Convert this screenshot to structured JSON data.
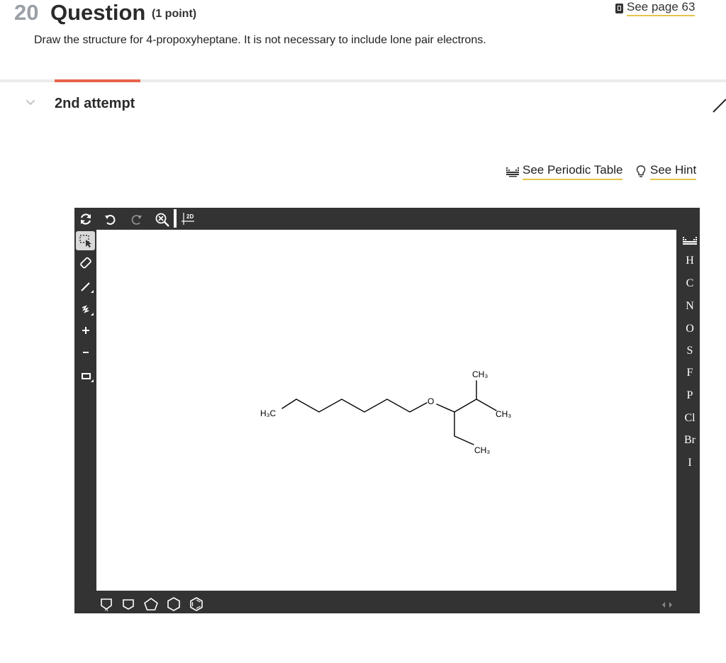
{
  "header": {
    "question_number": "20",
    "question_title": "Question",
    "points": "(1 point)",
    "see_page": "See page 63"
  },
  "prompt": "Draw the structure for 4-propoxyheptane. It is not necessary to include lone pair electrons.",
  "attempt": {
    "label": "2nd attempt"
  },
  "links": {
    "periodic_table": "See Periodic Table",
    "hint": "See Hint"
  },
  "toolbar_top": [
    "rotate-icon",
    "undo-icon",
    "redo-icon",
    "zoom-icon",
    "2d-clean-icon"
  ],
  "toolbar_top_badge": "2D",
  "toolbar_left": [
    "select-icon",
    "eraser-icon",
    "bond-icon",
    "chain-icon",
    "charge-plus-icon",
    "charge-minus-icon",
    "bracket-icon"
  ],
  "element_palette": {
    "elements": [
      "H",
      "C",
      "N",
      "O",
      "S",
      "F",
      "P",
      "Cl",
      "Br",
      "I"
    ]
  },
  "toolbar_bottom": [
    "template-icon",
    "cyclopentane-ring-icon",
    "pentagon-ring-icon",
    "hexagon-ring-icon",
    "benzene-ring-icon"
  ],
  "molecule_labels": {
    "h3c_left": "H₃C",
    "oxygen": "O",
    "ch3_top": "CH₃",
    "ch3_right": "CH₃",
    "ch3_bottom": "CH₃"
  },
  "colors": {
    "accent": "#e8644a",
    "link_underline": "#e6c34a",
    "editor_frame": "#333333"
  }
}
